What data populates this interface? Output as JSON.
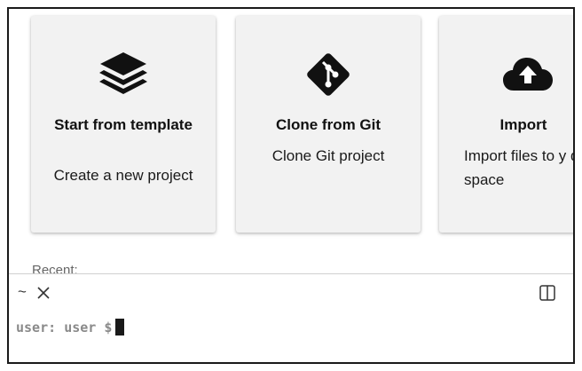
{
  "cards": [
    {
      "icon": "layers-icon",
      "title": "Start from template",
      "description": "Create a new project"
    },
    {
      "icon": "git-icon",
      "title": "Clone from Git",
      "description": "Clone Git project"
    },
    {
      "icon": "cloud-upload-icon",
      "title": "Import",
      "description": "Import files to y dev space"
    }
  ],
  "recent": {
    "label": "Recent:"
  },
  "terminal": {
    "tab_label": "~",
    "prompt_user": "user:",
    "prompt_path": "user",
    "prompt_symbol": "$"
  }
}
